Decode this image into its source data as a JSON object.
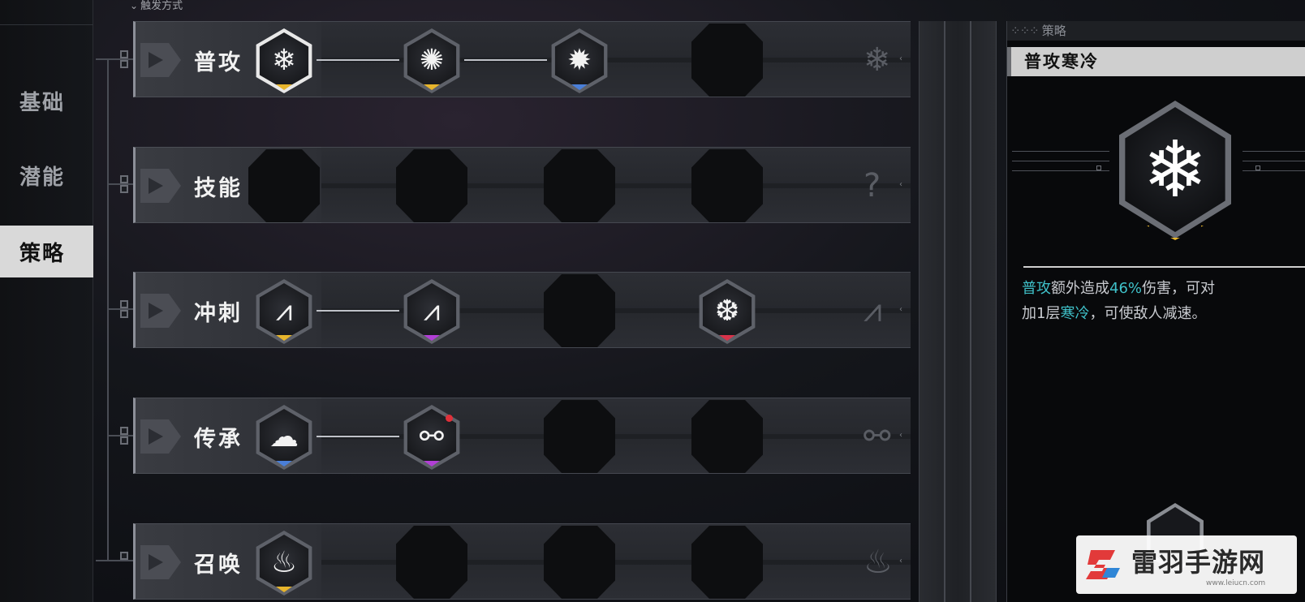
{
  "header": {
    "trigger_label": "触发方式"
  },
  "nav": {
    "items": [
      {
        "label": "基础",
        "active": false
      },
      {
        "label": "潜能",
        "active": false
      },
      {
        "label": "策略",
        "active": true
      }
    ]
  },
  "rows": [
    {
      "label": "普攻",
      "slots": [
        {
          "filled": true,
          "icon": "snowflake-icon",
          "glyph": "❄",
          "tier_color": "#e7b52c",
          "selected": true
        },
        {
          "filled": true,
          "icon": "frost-burst-icon",
          "glyph": "✺",
          "tier_color": "#e7b52c"
        },
        {
          "filled": true,
          "icon": "frost-burst-small-icon",
          "glyph": "✹",
          "tier_color": "#4a7fd8"
        },
        {
          "filled": false
        }
      ],
      "ghost_icon": "snowflake-ghost-icon",
      "ghost_glyph": "❄"
    },
    {
      "label": "技能",
      "slots": [
        {
          "filled": false
        },
        {
          "filled": false
        },
        {
          "filled": false
        },
        {
          "filled": false
        }
      ],
      "ghost_icon": "question-ghost-icon",
      "ghost_glyph": "?"
    },
    {
      "label": "冲刺",
      "slots": [
        {
          "filled": true,
          "icon": "claw-slash-icon",
          "glyph": "⩘",
          "tier_color": "#e7b52c"
        },
        {
          "filled": true,
          "icon": "claw-slash-icon",
          "glyph": "⩘",
          "tier_color": "#b23fd6"
        },
        {
          "filled": false
        },
        {
          "filled": true,
          "icon": "ice-shard-icon",
          "glyph": "❆",
          "tier_color": "#d8334a"
        }
      ],
      "ghost_icon": "claw-ghost-icon",
      "ghost_glyph": "⩘"
    },
    {
      "label": "传承",
      "slots": [
        {
          "filled": true,
          "icon": "storm-cloud-icon",
          "glyph": "☁",
          "tier_color": "#4a7fd8"
        },
        {
          "filled": true,
          "icon": "node-link-icon",
          "glyph": "⚯",
          "tier_color": "#b23fd6",
          "alert": true
        },
        {
          "filled": false
        },
        {
          "filled": false
        }
      ],
      "ghost_icon": "node-link-ghost-icon",
      "ghost_glyph": "⚯"
    },
    {
      "label": "召唤",
      "slots": [
        {
          "filled": true,
          "icon": "flame-icon",
          "glyph": "♨",
          "tier_color": "#e7b52c"
        },
        {
          "filled": false
        },
        {
          "filled": false
        },
        {
          "filled": false
        }
      ],
      "ghost_icon": "flame-ghost-icon",
      "ghost_glyph": "♨"
    }
  ],
  "detail": {
    "category": "策略",
    "title": "普攻寒冷",
    "icon": "snowflake-icon",
    "glyph": "❄",
    "tier_color": "#e7b52c",
    "desc_line1": {
      "a": "普攻",
      "b": "额外造成",
      "c": "46%",
      "d": "伤害，可对"
    },
    "desc_line2": {
      "a": "加1层",
      "b": "寒冷",
      "c": "，可使敌人减速。"
    }
  },
  "watermark": {
    "text": "雷羽手游网",
    "url": "www.leiucn.com"
  },
  "colors": {
    "accent_cyan": "#3fc1c9",
    "tier_gold": "#e7b52c",
    "tier_blue": "#4a7fd8",
    "tier_purple": "#b23fd6",
    "tier_red": "#d8334a"
  }
}
